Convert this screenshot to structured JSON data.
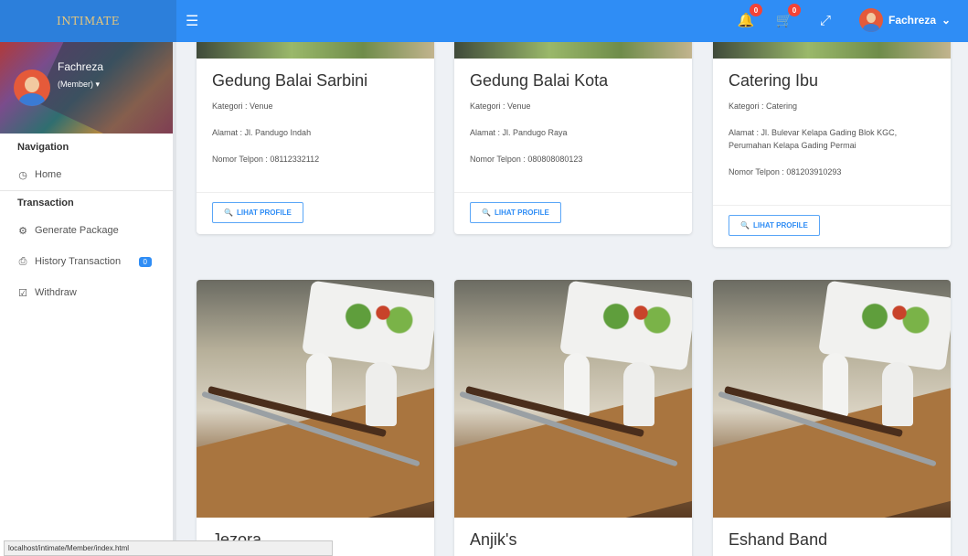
{
  "topbar": {
    "brand": "INTIMATE",
    "notifications_count": "0",
    "cart_count": "0",
    "username": "Fachreza",
    "colors": {
      "primary": "#2f8df5",
      "badge": "#f44336"
    }
  },
  "sidebar": {
    "profile_name": "Fachreza",
    "profile_role": "(Member)",
    "sections": [
      {
        "title": "Navigation",
        "items": [
          {
            "label": "Home",
            "icon": "clock-icon"
          }
        ]
      },
      {
        "title": "Transaction",
        "items": [
          {
            "label": "Generate Package",
            "icon": "gears-icon"
          },
          {
            "label": "History Transaction",
            "icon": "history-icon",
            "badge": "0"
          },
          {
            "label": "Withdraw",
            "icon": "bank-icon"
          }
        ]
      }
    ]
  },
  "cards_top": [
    {
      "title": "Gedung Balai Sarbini",
      "kategori": "Kategori : Venue",
      "alamat": "Alamat : Jl. Pandugo Indah",
      "telpon": "Nomor Telpon : 08112332112",
      "button": "LIHAT PROFILE"
    },
    {
      "title": "Gedung Balai Kota",
      "kategori": "Kategori : Venue",
      "alamat": "Alamat : Jl. Pandugo Raya",
      "telpon": "Nomor Telpon : 080808080123",
      "button": "LIHAT PROFILE"
    },
    {
      "title": "Catering Ibu",
      "kategori": "Kategori : Catering",
      "alamat": "Alamat : Jl. Bulevar Kelapa Gading Blok KGC, Perumahan Kelapa Gading Permai",
      "telpon": "Nomor Telpon : 081203910293",
      "button": "LIHAT PROFILE"
    }
  ],
  "cards_bottom": [
    {
      "title": "Jezora"
    },
    {
      "title": "Anjik's"
    },
    {
      "title": "Eshand Band"
    }
  ],
  "statusbar": "localhost/intimate/Member/index.html"
}
